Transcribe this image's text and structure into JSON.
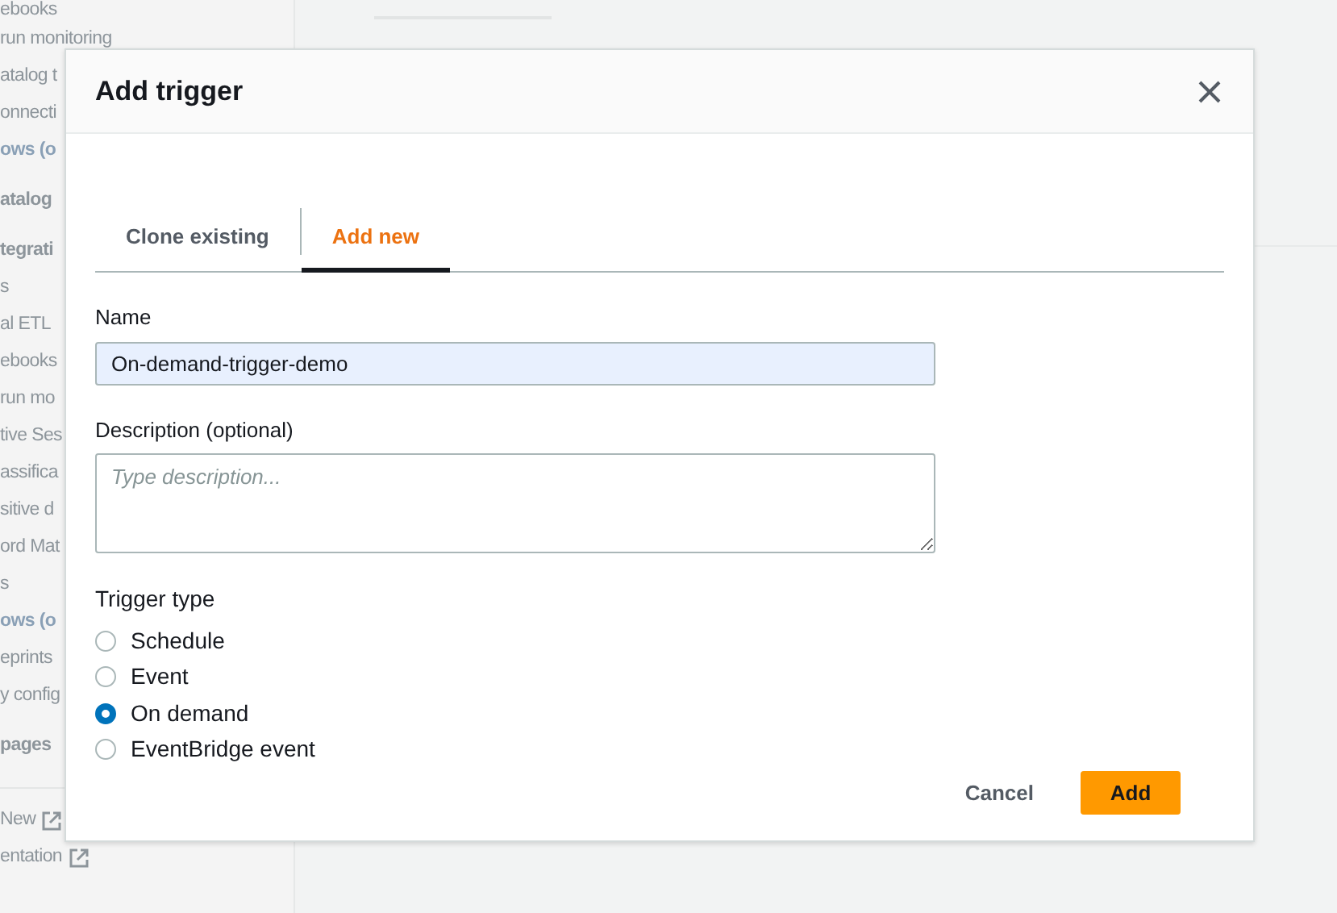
{
  "sidebar": {
    "items": [
      {
        "kind": "link",
        "label": "ebooks"
      },
      {
        "kind": "link",
        "label": "run monitoring"
      },
      {
        "kind": "link",
        "label": "atalog t"
      },
      {
        "kind": "link",
        "label": "onnecti"
      },
      {
        "kind": "section",
        "label": "ows (o"
      },
      {
        "kind": "heading",
        "label": "atalog"
      },
      {
        "kind": "heading",
        "label": "tegrati"
      },
      {
        "kind": "link",
        "label": "s"
      },
      {
        "kind": "link",
        "label": "al ETL"
      },
      {
        "kind": "link",
        "label": "ebooks"
      },
      {
        "kind": "link",
        "label": "run mo"
      },
      {
        "kind": "link",
        "label": "tive Ses"
      },
      {
        "kind": "link",
        "label": "assifica"
      },
      {
        "kind": "link",
        "label": "sitive d"
      },
      {
        "kind": "link",
        "label": "ord Mat"
      },
      {
        "kind": "link",
        "label": "s"
      },
      {
        "kind": "section",
        "label": "ows (o"
      },
      {
        "kind": "link",
        "label": "eprints"
      },
      {
        "kind": "link",
        "label": "y config"
      },
      {
        "kind": "heading",
        "label": "pages"
      },
      {
        "kind": "external",
        "label": "New"
      },
      {
        "kind": "external",
        "label": "entation"
      }
    ]
  },
  "dialog": {
    "title": "Add trigger",
    "tabs": [
      {
        "label": "Clone existing",
        "selected": false
      },
      {
        "label": "Add new",
        "selected": true
      }
    ],
    "name": {
      "label": "Name",
      "value": "On-demand-trigger-demo"
    },
    "description": {
      "label": "Description (optional)",
      "placeholder": "Type description..."
    },
    "trigger_type": {
      "label": "Trigger type",
      "options": [
        {
          "label": "Schedule",
          "selected": false
        },
        {
          "label": "Event",
          "selected": false
        },
        {
          "label": "On demand",
          "selected": true
        },
        {
          "label": "EventBridge event",
          "selected": false
        }
      ]
    },
    "buttons": [
      {
        "kind": "link",
        "label": "Cancel"
      },
      {
        "kind": "primary",
        "label": "Add"
      }
    ]
  }
}
